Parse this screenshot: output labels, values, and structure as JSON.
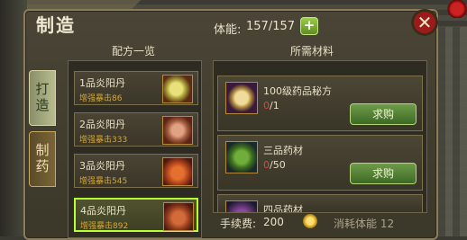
{
  "window": {
    "title": "制造",
    "close_symbol": "✕"
  },
  "stamina": {
    "label": "体能:",
    "value": "157/157",
    "plus_symbol": "+"
  },
  "tabs": [
    {
      "label": "打造"
    },
    {
      "label": "制药"
    }
  ],
  "recipes": {
    "header": "配方一览",
    "items": [
      {
        "name": "1品炎阳丹",
        "bonus": "增强暴击86"
      },
      {
        "name": "2品炎阳丹",
        "bonus": "增强暴击333"
      },
      {
        "name": "3品炎阳丹",
        "bonus": "增强暴击545"
      },
      {
        "name": "4品炎阳丹",
        "bonus": "增强暴击892"
      }
    ]
  },
  "materials": {
    "header": "所需材料",
    "items": [
      {
        "name": "100级药品秘方",
        "have": "0",
        "need": "/1",
        "button": "求购"
      },
      {
        "name": "三品药材",
        "have": "0",
        "need": "/50",
        "button": "求购"
      },
      {
        "name": "四品药材"
      }
    ]
  },
  "footer": {
    "fee_label": "手续费:",
    "fee_value": "200",
    "skill_text": "消耗体能 12"
  },
  "colors": {
    "selected_border": "#b7ff34",
    "shortfall": "#e24040",
    "bonus_text": "#d6a838"
  }
}
